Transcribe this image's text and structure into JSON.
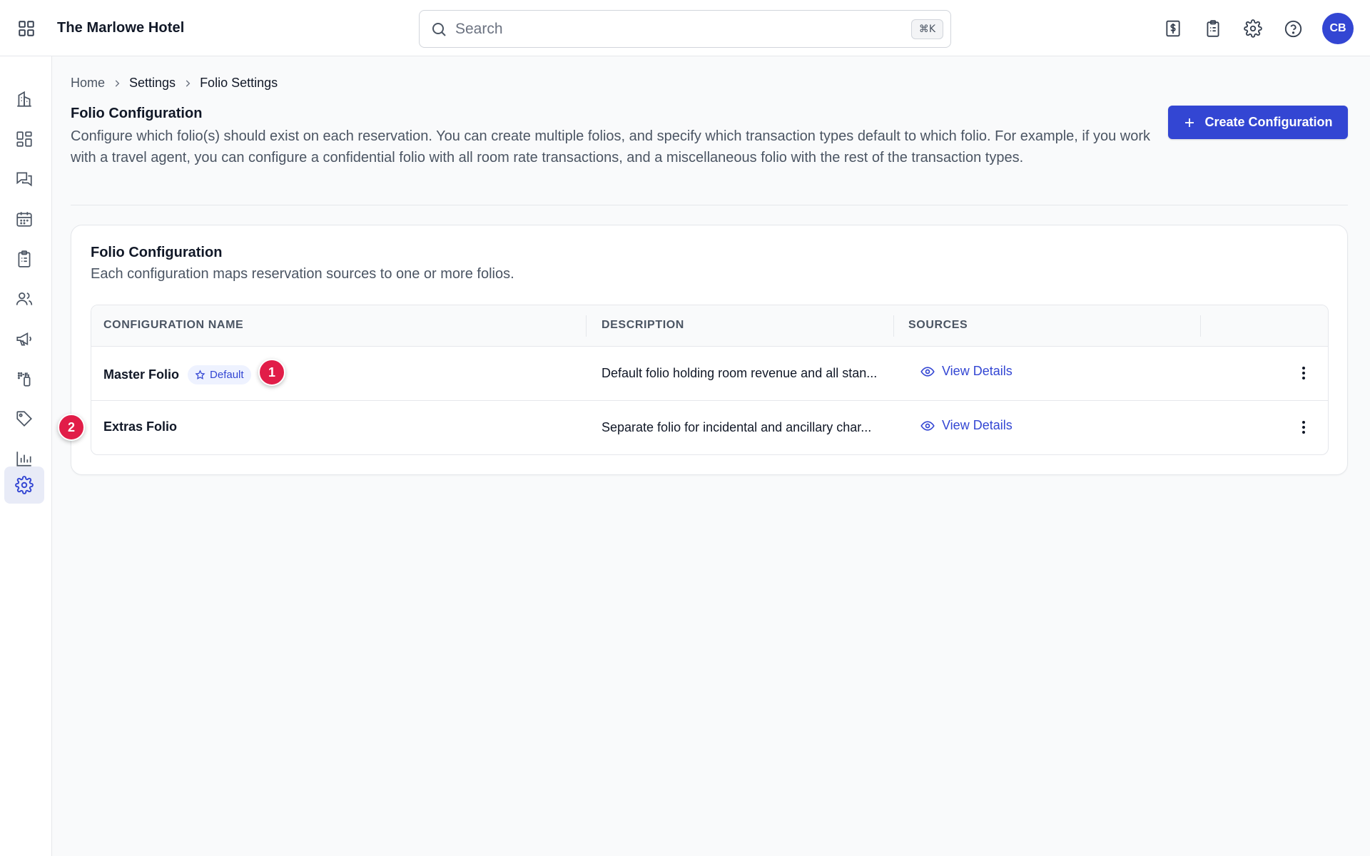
{
  "header": {
    "hotel_name": "The Marlowe Hotel",
    "search_placeholder": "Search",
    "search_shortcut": "⌘K",
    "avatar_initials": "CB",
    "icons": [
      "apps-grid-icon",
      "billing-icon",
      "clipboard-icon",
      "gear-icon",
      "help-icon"
    ]
  },
  "sidebar": {
    "items": [
      {
        "name": "properties",
        "icon": "building-icon"
      },
      {
        "name": "dashboard",
        "icon": "dashboard-icon"
      },
      {
        "name": "messages",
        "icon": "chat-icon"
      },
      {
        "name": "calendar",
        "icon": "calendar-icon"
      },
      {
        "name": "tasks",
        "icon": "clipboard-icon"
      },
      {
        "name": "guests",
        "icon": "users-icon"
      },
      {
        "name": "marketing",
        "icon": "megaphone-icon"
      },
      {
        "name": "housekeeping",
        "icon": "spray-icon"
      },
      {
        "name": "rates",
        "icon": "tag-icon"
      },
      {
        "name": "reports",
        "icon": "bar-chart-icon"
      },
      {
        "name": "settings",
        "icon": "gear-icon",
        "active": true
      }
    ]
  },
  "breadcrumb": {
    "home": "Home",
    "settings": "Settings",
    "current": "Folio Settings"
  },
  "page": {
    "title": "Folio Configuration",
    "description": "Configure which folio(s) should exist on each reservation. You can create multiple folios, and specify which transaction types default to which folio. For example, if you work with a travel agent, you can configure a confidential folio with all room rate transactions, and a miscellaneous folio with the rest of the transaction types.",
    "create_button": "Create Configuration"
  },
  "card": {
    "title": "Folio Configuration",
    "subtitle": "Each configuration maps reservation sources to one or more folios.",
    "columns": [
      "CONFIGURATION NAME",
      "DESCRIPTION",
      "SOURCES"
    ],
    "rows": [
      {
        "name": "Master Folio",
        "badge": "Default",
        "description": "Default folio holding room revenue and all stan...",
        "sources_link": "View Details"
      },
      {
        "name": "Extras Folio",
        "badge": "",
        "description": "Separate folio for incidental and ancillary char...",
        "sources_link": "View Details"
      }
    ]
  },
  "markers": [
    "1",
    "2"
  ],
  "colors": {
    "accent": "#3346d3",
    "marker": "#e11d48",
    "badge_bg": "#eef2ff"
  }
}
